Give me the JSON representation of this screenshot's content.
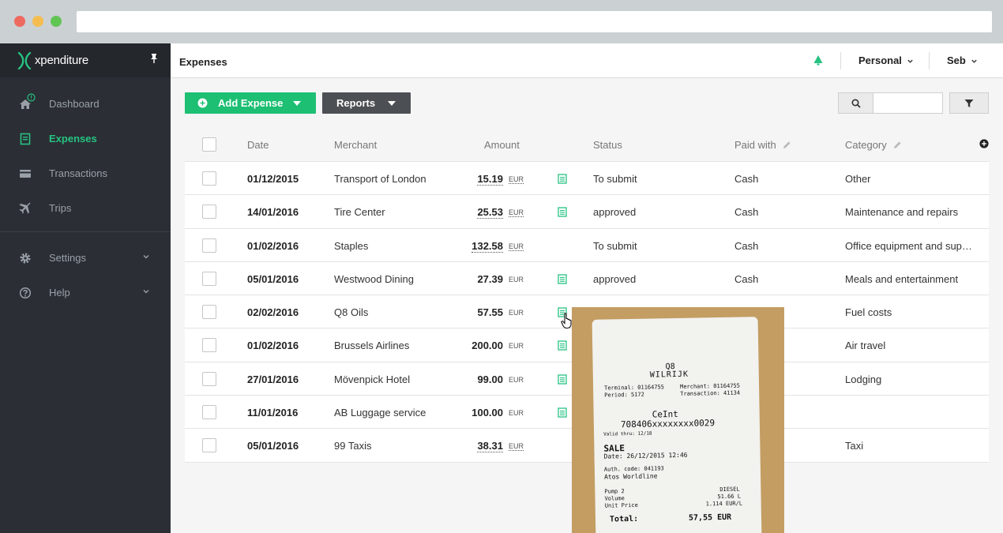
{
  "sidebar": {
    "brand": "xpenditure",
    "items": [
      {
        "label": "Dashboard"
      },
      {
        "label": "Expenses"
      },
      {
        "label": "Transactions"
      },
      {
        "label": "Trips"
      },
      {
        "label": "Settings"
      },
      {
        "label": "Help"
      }
    ]
  },
  "header": {
    "title": "Expenses",
    "account": "Personal",
    "user": "Seb"
  },
  "toolbar": {
    "add_label": "Add Expense",
    "reports_label": "Reports",
    "search_value": ""
  },
  "table": {
    "headers": {
      "date": "Date",
      "merchant": "Merchant",
      "amount": "Amount",
      "status": "Status",
      "paid_with": "Paid with",
      "category": "Category"
    },
    "rows": [
      {
        "date": "01/12/2015",
        "merchant": "Transport of London",
        "amount": "15.19",
        "currency": "EUR",
        "status": "To submit",
        "paid_with": "Cash",
        "category": "Other"
      },
      {
        "date": "14/01/2016",
        "merchant": "Tire Center",
        "amount": "25.53",
        "currency": "EUR",
        "status": "approved",
        "paid_with": "Cash",
        "category": "Maintenance and repairs"
      },
      {
        "date": "01/02/2016",
        "merchant": "Staples",
        "amount": "132.58",
        "currency": "EUR",
        "status": "To submit",
        "paid_with": "Cash",
        "category": "Office equipment and suppl…"
      },
      {
        "date": "05/01/2016",
        "merchant": "Westwood Dining",
        "amount": "27.39",
        "currency": "EUR",
        "status": "approved",
        "paid_with": "Cash",
        "category": "Meals and entertainment"
      },
      {
        "date": "02/02/2016",
        "merchant": "Q8 Oils",
        "amount": "57.55",
        "currency": "EUR",
        "status": "",
        "paid_with": "",
        "category": "Fuel costs"
      },
      {
        "date": "01/02/2016",
        "merchant": "Brussels Airlines",
        "amount": "200.00",
        "currency": "EUR",
        "status": "",
        "paid_with": "",
        "category": "Air travel"
      },
      {
        "date": "27/01/2016",
        "merchant": "Mövenpick Hotel",
        "amount": "99.00",
        "currency": "EUR",
        "status": "",
        "paid_with": "",
        "category": "Lodging"
      },
      {
        "date": "11/01/2016",
        "merchant": "AB Luggage service",
        "amount": "100.00",
        "currency": "EUR",
        "status": "",
        "paid_with": "",
        "category": ""
      },
      {
        "date": "05/01/2016",
        "merchant": "99 Taxis",
        "amount": "38.31",
        "currency": "EUR",
        "status": "",
        "paid_with": "",
        "category": "Taxi"
      }
    ]
  },
  "receipt": {
    "store": "Q8",
    "city": "WILRIJK",
    "terminal": "Terminal: 01164755",
    "merchant": "Merchant:    01164755",
    "period": "Period:    5172",
    "transaction": "Transaction:    41134",
    "card": "CeInt",
    "number": "708406xxxxxxxx0029",
    "valid": "Valid thru: 12/18",
    "sale": "SALE",
    "date": "Date: 26/12/2015 12:46",
    "auth": "Auth. code: 041193",
    "provider": "Atos Worldline",
    "pump": "Pump 2",
    "pump_value": "DIESEL",
    "volume": "Volume",
    "volume_value": "51.66 L",
    "unit_price": "Unit Price",
    "unit_price_value": "1.114 EUR/L",
    "total": "Total:",
    "total_value": "57,55 EUR"
  },
  "colors": {
    "accent": "#1dbf73",
    "sidebar": "#2b2f35",
    "reports_btn": "#4c4f53"
  }
}
